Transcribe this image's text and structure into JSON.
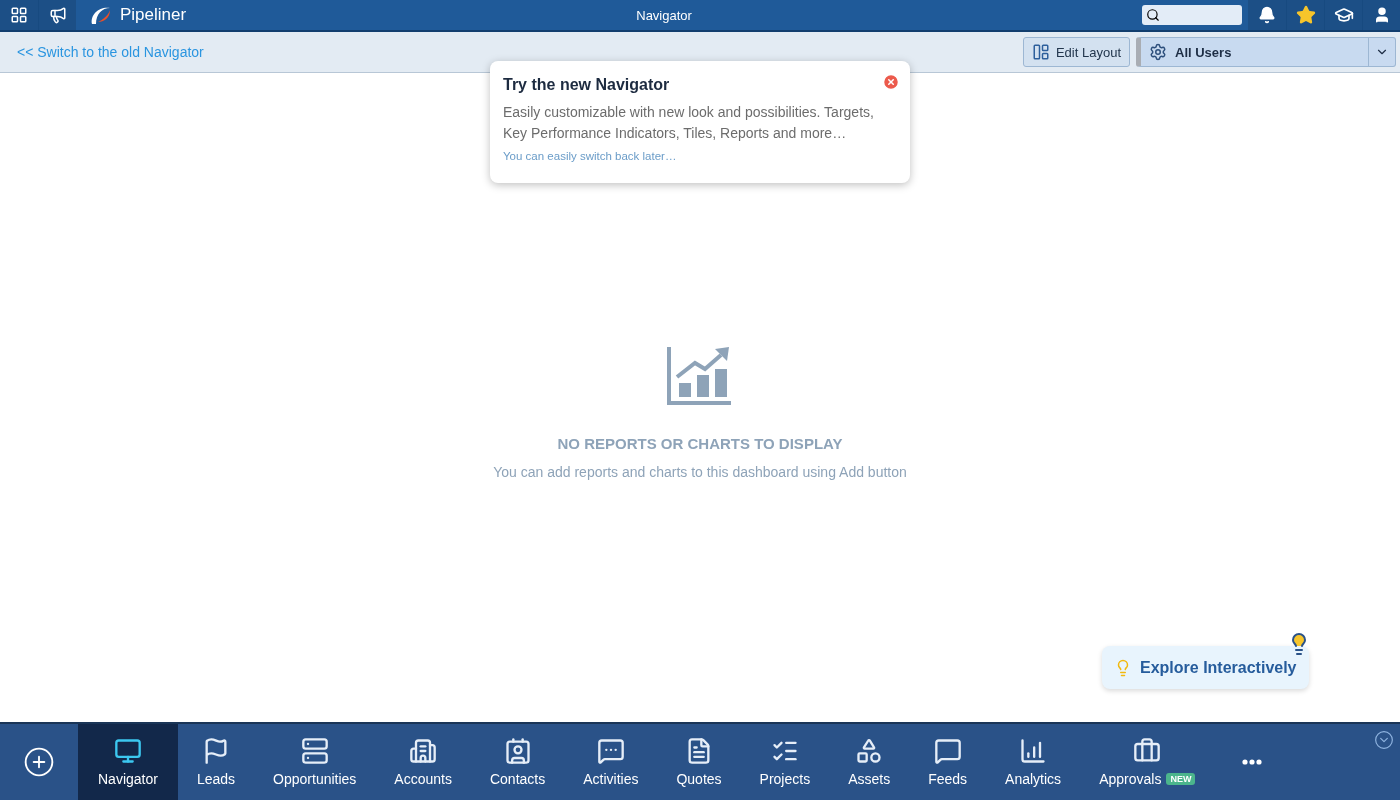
{
  "top_bar": {
    "brand": "Pipeliner",
    "title": "Navigator"
  },
  "sub_bar": {
    "switch_link": "<< Switch to the old Navigator",
    "edit_layout": "Edit Layout",
    "user_filter": "All Users"
  },
  "popup": {
    "title": "Try the new Navigator",
    "body": "Easily customizable with new look and possibilities. Targets, Key Performance Indicators, Tiles, Reports and more…",
    "note": "You can easily switch back later…"
  },
  "empty_state": {
    "heading": "NO REPORTS OR CHARTS TO DISPLAY",
    "text": "You can add reports and charts to this dashboard using Add button"
  },
  "explore_button": "Explore Interactively",
  "bottom_nav": [
    {
      "kind": "navigator",
      "label": "Navigator",
      "selected": true
    },
    {
      "kind": "leads",
      "label": "Leads",
      "selected": false
    },
    {
      "kind": "opportunities",
      "label": "Opportunities",
      "selected": false
    },
    {
      "kind": "accounts",
      "label": "Accounts",
      "selected": false
    },
    {
      "kind": "contacts",
      "label": "Contacts",
      "selected": false
    },
    {
      "kind": "activities",
      "label": "Activities",
      "selected": false
    },
    {
      "kind": "quotes",
      "label": "Quotes",
      "selected": false
    },
    {
      "kind": "projects",
      "label": "Projects",
      "selected": false
    },
    {
      "kind": "assets",
      "label": "Assets",
      "selected": false
    },
    {
      "kind": "feeds",
      "label": "Feeds",
      "selected": false
    },
    {
      "kind": "analytics",
      "label": "Analytics",
      "selected": false
    },
    {
      "kind": "approvals",
      "label": "Approvals",
      "selected": false,
      "badge": "NEW"
    }
  ]
}
